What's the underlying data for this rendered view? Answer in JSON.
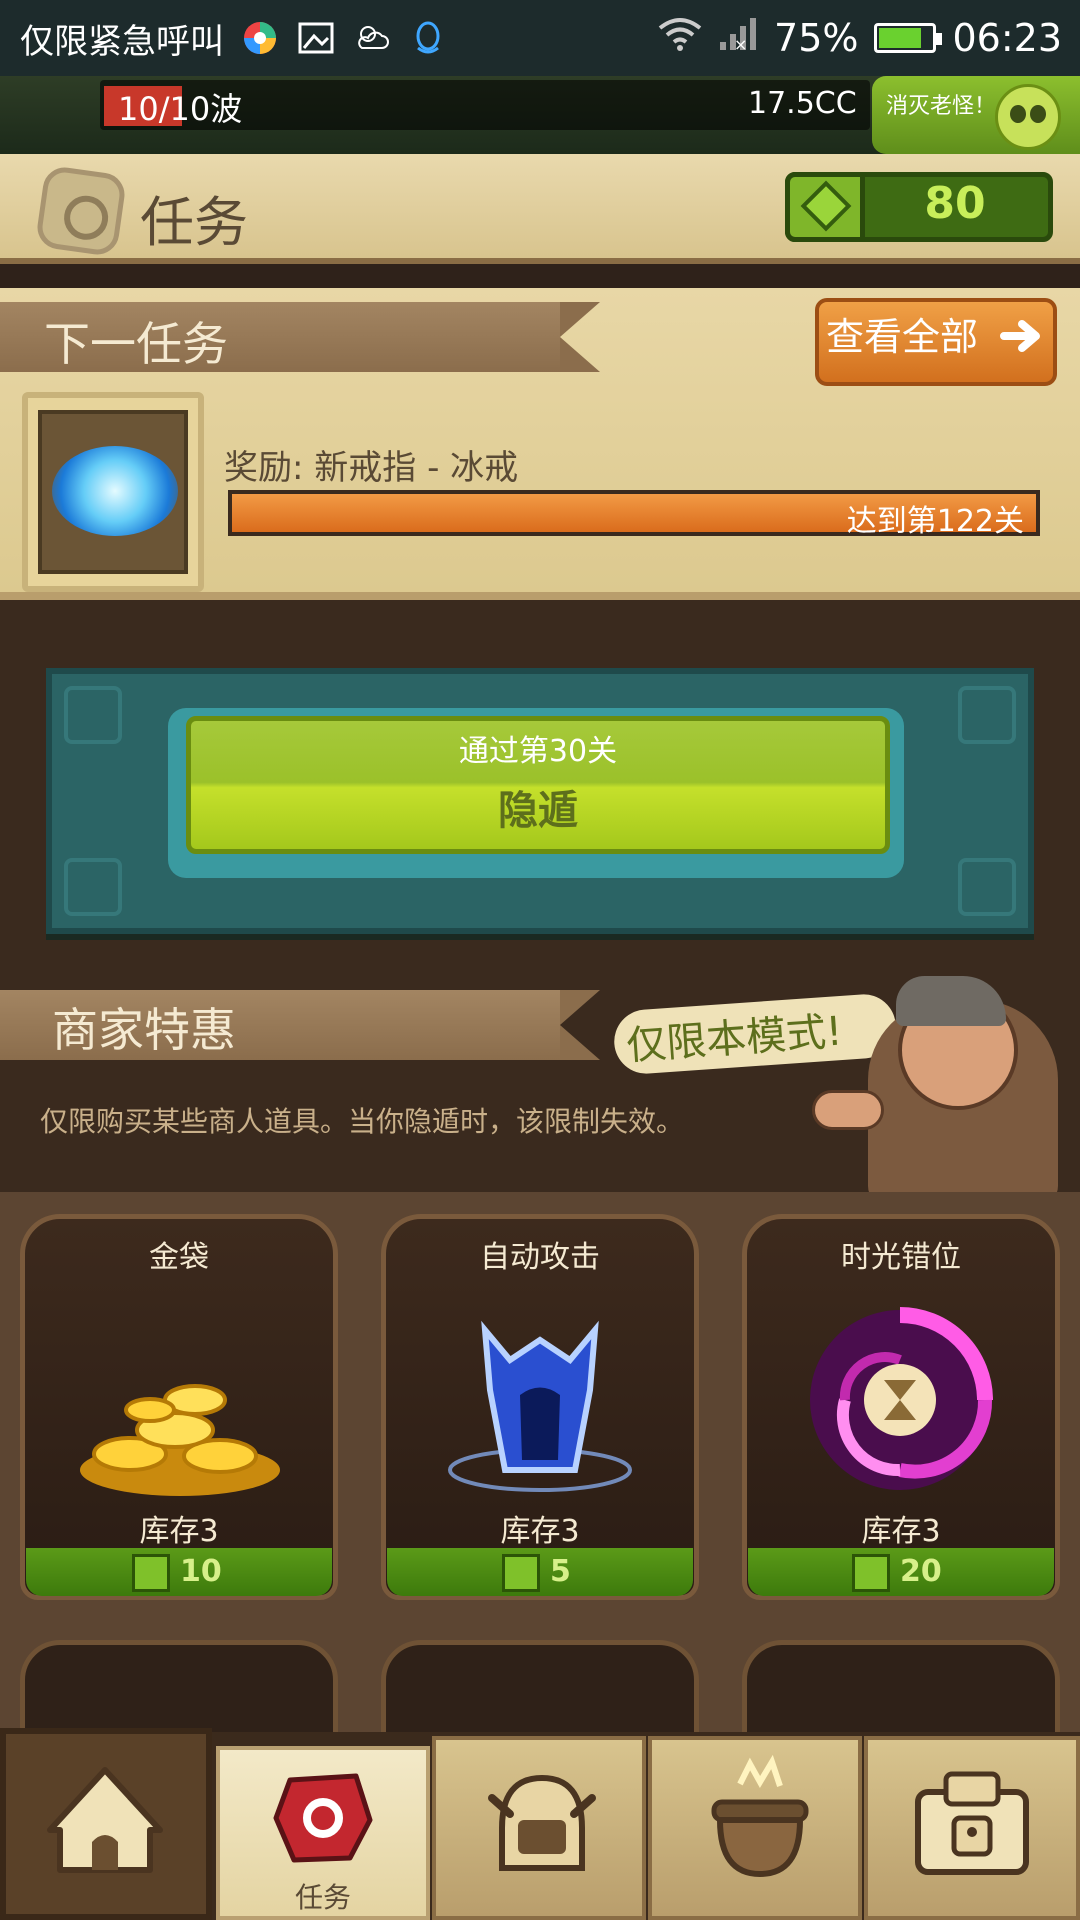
{
  "status_bar": {
    "carrier": "仅限紧急呼叫",
    "battery": "75%",
    "time": "06:23"
  },
  "game_banner": {
    "wave": "10/10波",
    "currency_rate": "17.5CC",
    "boss_button": "消灭老怪！"
  },
  "header": {
    "title": "任务",
    "gems": "80"
  },
  "next_quest": {
    "heading": "下一任务",
    "view_all": "查看全部",
    "reward": "奖励: 新戒指 - 冰戒",
    "progress_label": "达到第122关",
    "progress_fraction": 1.0
  },
  "challenge": {
    "line1": "通过第30关",
    "line2": "隐遁"
  },
  "merchant": {
    "heading": "商家特惠",
    "bubble": "仅限本模式!",
    "description": "仅限购买某些商人道具。当你隐遁时，该限制失效。"
  },
  "shop_items": [
    {
      "title": "金袋",
      "stock": "库存3",
      "price": "10"
    },
    {
      "title": "自动攻击",
      "stock": "库存3",
      "price": "5"
    },
    {
      "title": "时光错位",
      "stock": "库存3",
      "price": "20"
    }
  ],
  "nav": {
    "active_label": "任务"
  },
  "colors": {
    "accent_green": "#9bc12a",
    "accent_orange": "#e07a22",
    "teal": "#2b6465"
  }
}
